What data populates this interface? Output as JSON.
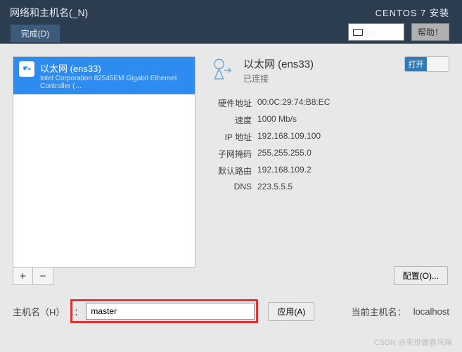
{
  "topbar": {
    "title": "网络和主机名(_N)",
    "done_label": "完成(D)",
    "install_title": "CENTOS 7 安装",
    "lang_code": "cn",
    "help_label": "帮助！"
  },
  "network_item": {
    "name": "以太网 (ens33)",
    "device": "Intel Corporation 82545EM Gigabit Ethernet Controller (…"
  },
  "buttons": {
    "add": "+",
    "remove": "−",
    "configure": "配置(O)...",
    "apply": "应用(A)"
  },
  "detail_header": {
    "name": "以太网 (ens33)",
    "status": "已连接"
  },
  "toggle": {
    "on_label": "打开"
  },
  "details": {
    "hw_label": "硬件地址",
    "hw_value": "00:0C:29:74:B8:EC",
    "speed_label": "速度",
    "speed_value": "1000 Mb/s",
    "ip_label": "IP 地址",
    "ip_value": "192.168.109.100",
    "mask_label": "子网掩码",
    "mask_value": "255.255.255.0",
    "route_label": "默认路由",
    "route_value": "192.168.109.2",
    "dns_label": "DNS",
    "dns_value": "223.5.5.5"
  },
  "hostname": {
    "label": "主机名（H）",
    "colon": "：",
    "value": "master",
    "current_label": "当前主机名：",
    "current_value": "localhost"
  },
  "watermark": "CSDN @来世做春风嘛"
}
